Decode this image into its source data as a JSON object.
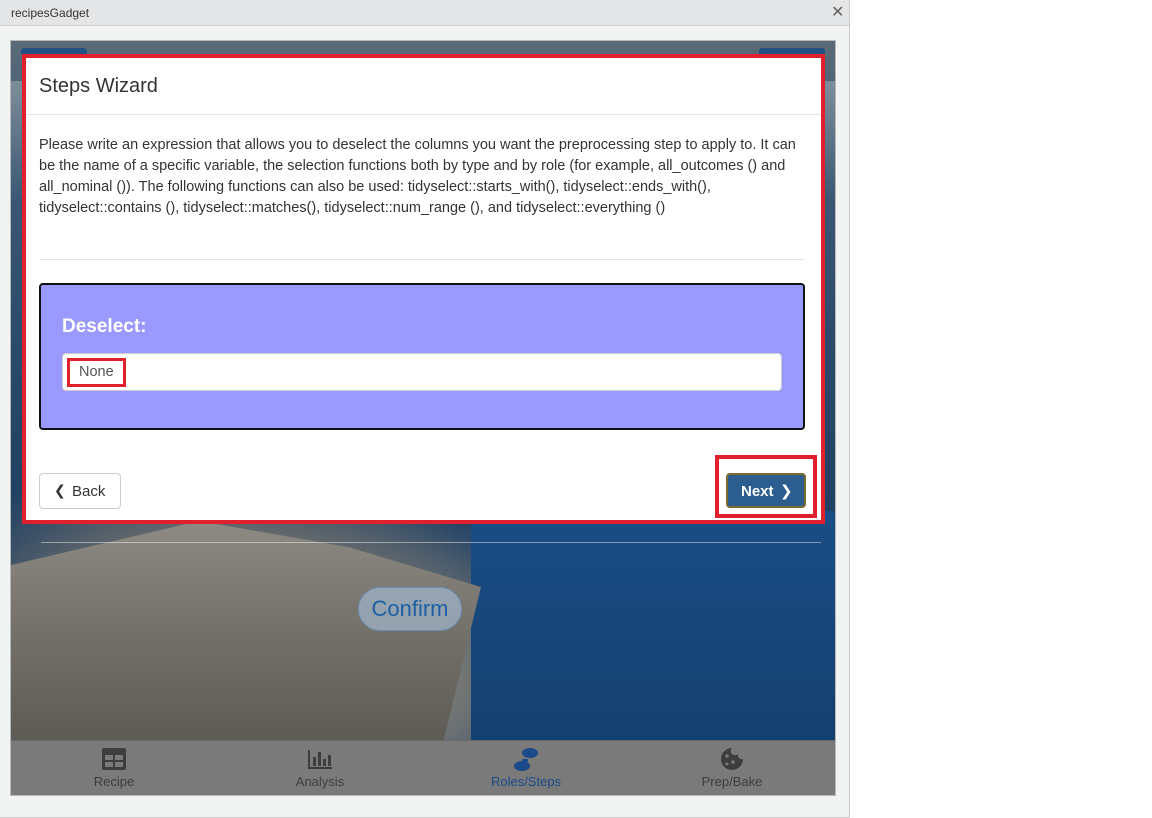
{
  "window": {
    "title": "recipesGadget",
    "close_glyph": "✕"
  },
  "wizard": {
    "title": "Steps Wizard",
    "description": "Please write an expression that allows you to deselect the columns you want the preprocessing step to apply to. It can be the name of a specific variable, the selection functions both by type and by role (for example, all_outcomes () and all_nominal ()). The following functions can also be used: tidyselect::starts_with(), tidyselect::ends_with(), tidyselect::contains (), tidyselect::matches(), tidyselect::num_range (), and tidyselect::everything ()",
    "field_label": "Deselect:",
    "field_value": "None",
    "back_label": "Back",
    "next_label": "Next",
    "panel_color": "#9999ff",
    "highlight_color": "#e0202d"
  },
  "confirm_label": "Confirm",
  "navbar": {
    "items": [
      {
        "label": "Recipe",
        "icon": "table-icon"
      },
      {
        "label": "Analysis",
        "icon": "bar-chart-icon"
      },
      {
        "label": "Roles/Steps",
        "icon": "footsteps-icon",
        "active": true
      },
      {
        "label": "Prep/Bake",
        "icon": "cookie-icon"
      }
    ]
  }
}
